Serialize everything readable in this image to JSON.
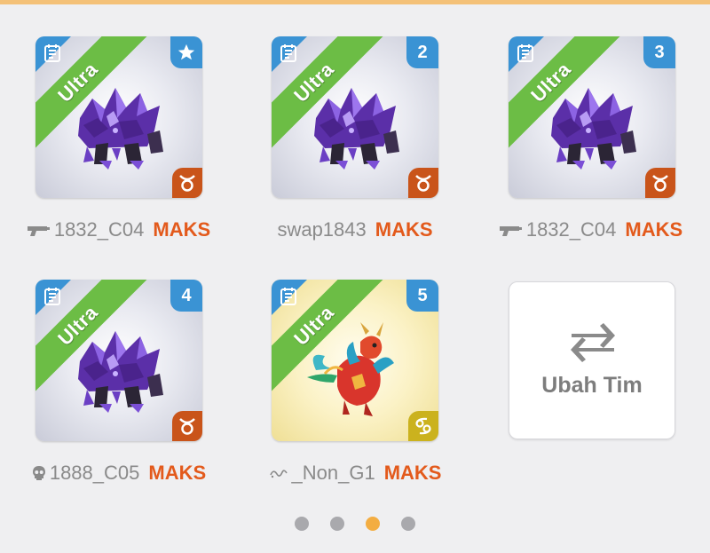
{
  "accent_color": "#e35a1c",
  "tier_label": "Ultra",
  "slots": [
    {
      "badge": "",
      "badge_icon": "star-icon",
      "element": "taurus",
      "element_icon": "taurus-icon",
      "creature": "purple-crystal-beast",
      "owner_icon": "gun-icon",
      "owner": "1832_C04",
      "level": "MAKS"
    },
    {
      "badge": "2",
      "element": "taurus",
      "element_icon": "taurus-icon",
      "creature": "purple-crystal-beast",
      "owner_icon": "",
      "owner": "swap1843",
      "level": "MAKS"
    },
    {
      "badge": "3",
      "element": "taurus",
      "element_icon": "taurus-icon",
      "creature": "purple-crystal-beast",
      "owner_icon": "gun-icon",
      "owner": "1832_C04",
      "level": "MAKS"
    },
    {
      "badge": "4",
      "element": "taurus",
      "element_icon": "taurus-icon",
      "creature": "purple-crystal-beast",
      "owner_icon": "skull-icon",
      "owner": "1888_C05",
      "level": "MAKS"
    },
    {
      "badge": "5",
      "element": "cancer",
      "element_icon": "cancer-icon",
      "creature": "red-feathered-dragon",
      "owner_icon": "squiggle-icon",
      "owner": "_Non_G1",
      "level": "MAKS"
    }
  ],
  "switch_team": {
    "label": "Ubah Tim",
    "icon": "swap-arrows-icon"
  },
  "pagination": {
    "count": 4,
    "active_index": 2
  }
}
